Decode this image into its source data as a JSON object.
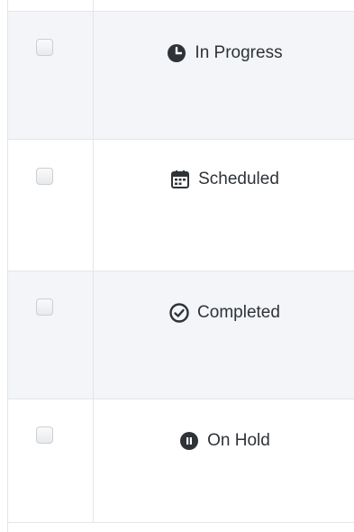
{
  "table": {
    "rows": [
      {
        "status": "In Progress",
        "icon": "clock-icon",
        "checked": false
      },
      {
        "status": "Scheduled",
        "icon": "calendar-icon",
        "checked": false
      },
      {
        "status": "Completed",
        "icon": "check-circle-icon",
        "checked": false
      },
      {
        "status": "On Hold",
        "icon": "pause-circle-icon",
        "checked": false
      }
    ]
  },
  "colors": {
    "row_shaded": "#f3f5f8",
    "row_plain": "#ffffff",
    "border": "#e3e6ea",
    "text": "#2f3338"
  }
}
